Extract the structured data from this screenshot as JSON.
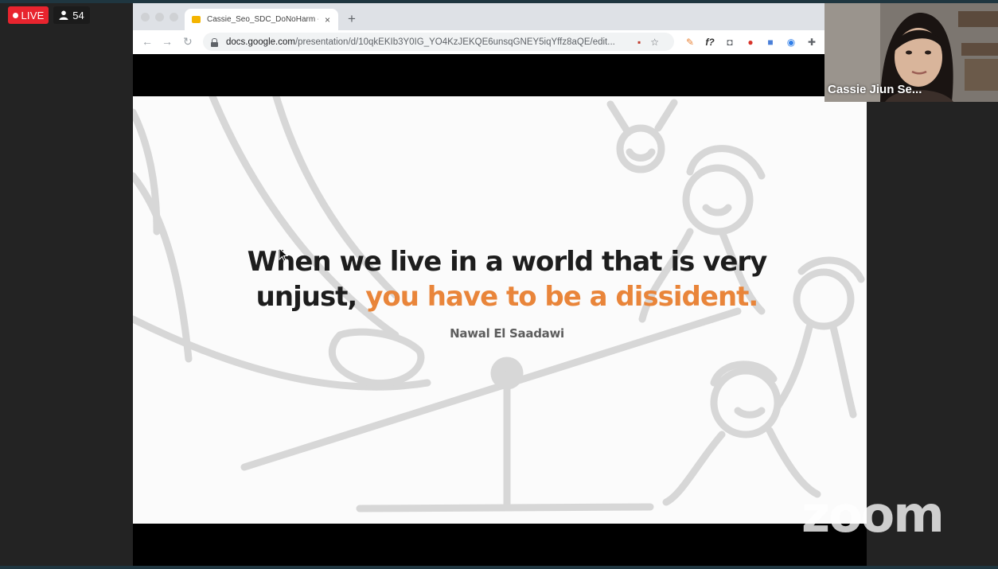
{
  "stream": {
    "live_label": "LIVE",
    "viewer_count": "54"
  },
  "browser": {
    "tab_title": "Cassie_Seo_SDC_DoNoHarm -",
    "tab_close": "×",
    "new_tab": "+",
    "url_host": "docs.google.com",
    "url_path": "/presentation/d/10qkEKIb3Y0IG_YO4KzJEKQE6unsqGNEY5iqYffz8aQE/edit...",
    "extensions": [
      "camera-blocked-icon",
      "star-icon",
      "pen-icon",
      "function-icon",
      "screenshot-icon",
      "opera-icon",
      "extension-icon",
      "safari-icon",
      "puzzle-icon"
    ]
  },
  "slide": {
    "quote_black_1": "When we live in a world that is very",
    "quote_black_2": "unjust, ",
    "quote_orange": "you have to be a dissident.",
    "author": "Nawal El Saadawi",
    "accent_color": "#e9853a"
  },
  "participant": {
    "name": "Cassie Jiun Se..."
  },
  "watermark": "zoom"
}
